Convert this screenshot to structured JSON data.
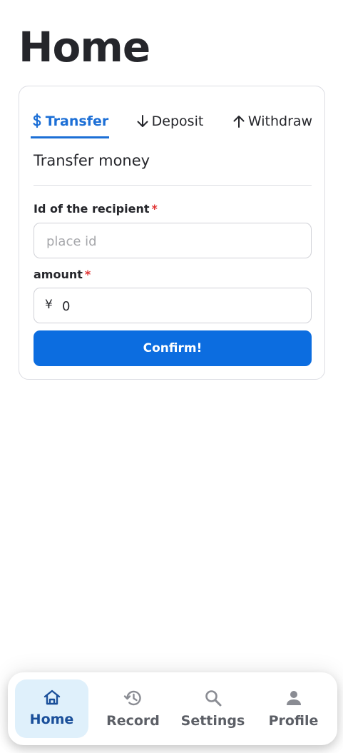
{
  "page": {
    "title": "Home"
  },
  "tabs": [
    {
      "label": "Transfer",
      "icon": "dollar-icon",
      "active": true
    },
    {
      "label": "Deposit",
      "icon": "arrow-down-icon",
      "active": false
    },
    {
      "label": "Withdraw",
      "icon": "arrow-up-icon",
      "active": false
    }
  ],
  "form": {
    "title": "Transfer money",
    "recipient": {
      "label": "Id of the recipient",
      "required_mark": "*",
      "placeholder": "place id",
      "value": ""
    },
    "amount": {
      "label": "amount",
      "required_mark": "*",
      "currency": "¥",
      "value": "0"
    },
    "confirm_label": "Confirm!"
  },
  "nav": [
    {
      "label": "Home",
      "icon": "home-icon",
      "active": true
    },
    {
      "label": "Record",
      "icon": "history-icon",
      "active": false
    },
    {
      "label": "Settings",
      "icon": "search-icon",
      "active": false
    },
    {
      "label": "Profile",
      "icon": "person-icon",
      "active": false
    }
  ],
  "colors": {
    "accent": "#0c6de0",
    "active_tab": "#1c6fd6",
    "nav_active_bg": "#dff0fb",
    "nav_active_text": "#1a4f9a",
    "required": "#e03131"
  }
}
